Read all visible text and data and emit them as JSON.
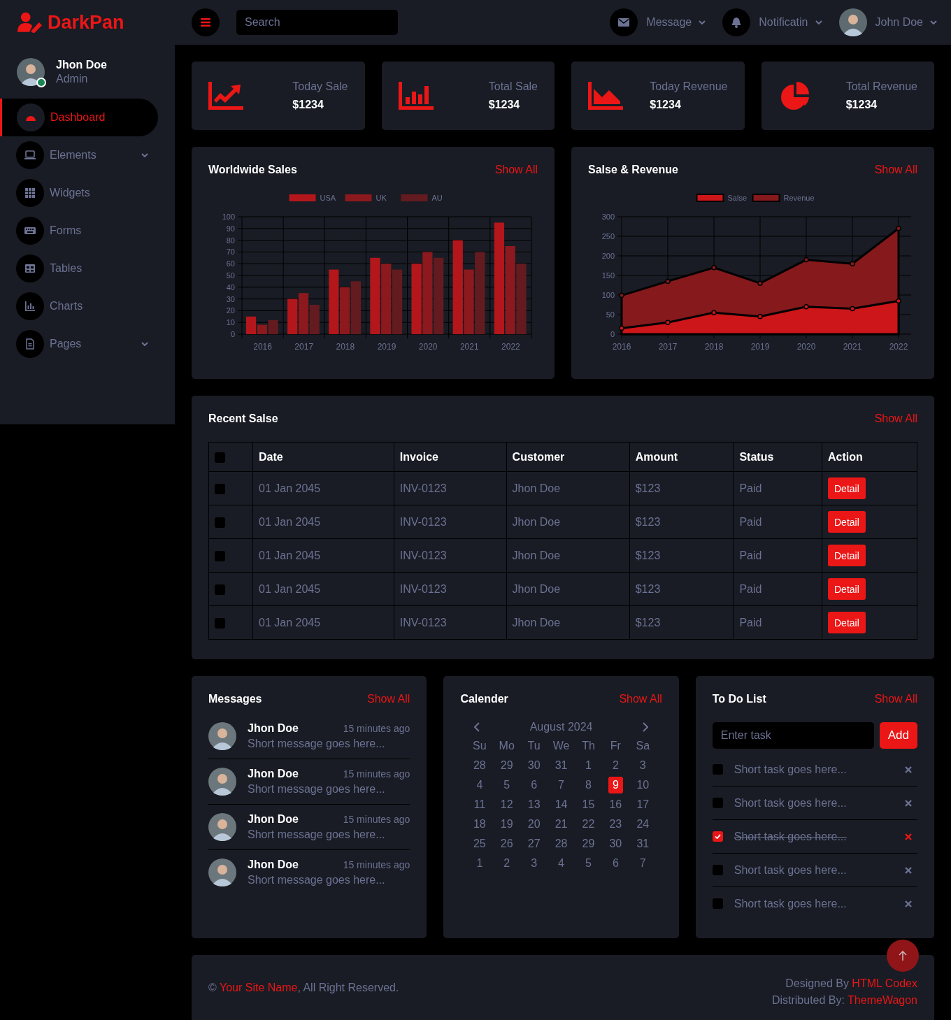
{
  "brand": {
    "name": "DarkPan"
  },
  "user": {
    "name": "Jhon Doe",
    "role": "Admin",
    "online": true
  },
  "sidebar": {
    "items": [
      {
        "label": "Dashboard",
        "kind": "gauge",
        "selected": true,
        "has_submenu": false
      },
      {
        "label": "Elements",
        "kind": "laptop",
        "selected": false,
        "has_submenu": true
      },
      {
        "label": "Widgets",
        "kind": "grid",
        "selected": false,
        "has_submenu": false
      },
      {
        "label": "Forms",
        "kind": "keyboard",
        "selected": false,
        "has_submenu": false
      },
      {
        "label": "Tables",
        "kind": "table",
        "selected": false,
        "has_submenu": false
      },
      {
        "label": "Charts",
        "kind": "chart",
        "selected": false,
        "has_submenu": false
      },
      {
        "label": "Pages",
        "kind": "file",
        "selected": false,
        "has_submenu": true
      }
    ]
  },
  "topbar": {
    "search": {
      "placeholder": "Search"
    },
    "items": [
      {
        "label": "Message",
        "kind": "envelope"
      },
      {
        "label": "Notificatin",
        "kind": "bell"
      },
      {
        "label": "John Doe",
        "kind": "avatar"
      }
    ]
  },
  "stats": [
    {
      "label": "Today Sale",
      "value": "$1234",
      "kind": "line"
    },
    {
      "label": "Total Sale",
      "value": "$1234",
      "kind": "bar"
    },
    {
      "label": "Today Revenue",
      "value": "$1234",
      "kind": "area"
    },
    {
      "label": "Total Revenue",
      "value": "$1234",
      "kind": "pie"
    }
  ],
  "charts": [
    {
      "title": "Worldwide Sales",
      "link": "Show All",
      "chart_data": {
        "type": "bar",
        "grid": true,
        "legend": "top",
        "categories": [
          "2016",
          "2017",
          "2018",
          "2019",
          "2020",
          "2021",
          "2022"
        ],
        "ylim": [
          0,
          100
        ],
        "yticks": [
          0,
          10,
          20,
          30,
          40,
          50,
          60,
          70,
          80,
          90,
          100
        ],
        "series": [
          {
            "name": "USA",
            "color": "#b3171b",
            "values": [
              15,
              30,
              55,
              65,
              60,
              80,
              95
            ]
          },
          {
            "name": "UK",
            "color": "#8c191d",
            "values": [
              8,
              35,
              40,
              60,
              70,
              55,
              75
            ]
          },
          {
            "name": "AU",
            "color": "#641b1f",
            "values": [
              12,
              25,
              45,
              55,
              65,
              70,
              60
            ]
          }
        ]
      }
    },
    {
      "title": "Salse & Revenue",
      "link": "Show All",
      "chart_data": {
        "type": "area",
        "grid": true,
        "legend": "top",
        "categories": [
          "2016",
          "2017",
          "2018",
          "2019",
          "2020",
          "2021",
          "2022"
        ],
        "ylim": [
          0,
          300
        ],
        "yticks": [
          0,
          50,
          100,
          150,
          200,
          250,
          300
        ],
        "series": [
          {
            "name": "Salse",
            "color": "#cc1619",
            "values": [
              15,
              30,
              55,
              45,
              70,
              65,
              85
            ]
          },
          {
            "name": "Revenue",
            "color": "#85191c",
            "values": [
              99,
              135,
              170,
              130,
              190,
              180,
              270
            ]
          }
        ]
      }
    }
  ],
  "recent_sales": {
    "title": "Recent Salse",
    "link": "Show All",
    "select_all": {
      "checked": false
    },
    "columns": [
      "Date",
      "Invoice",
      "Customer",
      "Amount",
      "Status",
      "Action"
    ],
    "rows": [
      {
        "checked": false,
        "date": "01 Jan 2045",
        "invoice": "INV-0123",
        "customer": "Jhon Doe",
        "amount": "$123",
        "status": "Paid",
        "action": "Detail"
      },
      {
        "checked": false,
        "date": "01 Jan 2045",
        "invoice": "INV-0123",
        "customer": "Jhon Doe",
        "amount": "$123",
        "status": "Paid",
        "action": "Detail"
      },
      {
        "checked": false,
        "date": "01 Jan 2045",
        "invoice": "INV-0123",
        "customer": "Jhon Doe",
        "amount": "$123",
        "status": "Paid",
        "action": "Detail"
      },
      {
        "checked": false,
        "date": "01 Jan 2045",
        "invoice": "INV-0123",
        "customer": "Jhon Doe",
        "amount": "$123",
        "status": "Paid",
        "action": "Detail"
      },
      {
        "checked": false,
        "date": "01 Jan 2045",
        "invoice": "INV-0123",
        "customer": "Jhon Doe",
        "amount": "$123",
        "status": "Paid",
        "action": "Detail"
      }
    ]
  },
  "messages": {
    "title": "Messages",
    "link": "Show All",
    "items": [
      {
        "name": "Jhon Doe",
        "time": "15 minutes ago",
        "text": "Short message goes here..."
      },
      {
        "name": "Jhon Doe",
        "time": "15 minutes ago",
        "text": "Short message goes here..."
      },
      {
        "name": "Jhon Doe",
        "time": "15 minutes ago",
        "text": "Short message goes here..."
      },
      {
        "name": "Jhon Doe",
        "time": "15 minutes ago",
        "text": "Short message goes here..."
      }
    ]
  },
  "calendar": {
    "title": "Calender",
    "link": "Show All",
    "month": "August 2024",
    "weekdays": [
      "Su",
      "Mo",
      "Tu",
      "We",
      "Th",
      "Fr",
      "Sa"
    ],
    "days": [
      {
        "d": "28",
        "selected": false
      },
      {
        "d": "29",
        "selected": false
      },
      {
        "d": "30",
        "selected": false
      },
      {
        "d": "31",
        "selected": false
      },
      {
        "d": "1",
        "selected": false
      },
      {
        "d": "2",
        "selected": false
      },
      {
        "d": "3",
        "selected": false
      },
      {
        "d": "4",
        "selected": false
      },
      {
        "d": "5",
        "selected": false
      },
      {
        "d": "6",
        "selected": false
      },
      {
        "d": "7",
        "selected": false
      },
      {
        "d": "8",
        "selected": false
      },
      {
        "d": "9",
        "selected": true
      },
      {
        "d": "10",
        "selected": false
      },
      {
        "d": "11",
        "selected": false
      },
      {
        "d": "12",
        "selected": false
      },
      {
        "d": "13",
        "selected": false
      },
      {
        "d": "14",
        "selected": false
      },
      {
        "d": "15",
        "selected": false
      },
      {
        "d": "16",
        "selected": false
      },
      {
        "d": "17",
        "selected": false
      },
      {
        "d": "18",
        "selected": false
      },
      {
        "d": "19",
        "selected": false
      },
      {
        "d": "20",
        "selected": false
      },
      {
        "d": "21",
        "selected": false
      },
      {
        "d": "22",
        "selected": false
      },
      {
        "d": "23",
        "selected": false
      },
      {
        "d": "24",
        "selected": false
      },
      {
        "d": "25",
        "selected": false
      },
      {
        "d": "26",
        "selected": false
      },
      {
        "d": "27",
        "selected": false
      },
      {
        "d": "28",
        "selected": false
      },
      {
        "d": "29",
        "selected": false
      },
      {
        "d": "30",
        "selected": false
      },
      {
        "d": "31",
        "selected": false
      },
      {
        "d": "1",
        "selected": false
      },
      {
        "d": "2",
        "selected": false
      },
      {
        "d": "3",
        "selected": false
      },
      {
        "d": "4",
        "selected": false
      },
      {
        "d": "5",
        "selected": false
      },
      {
        "d": "6",
        "selected": false
      },
      {
        "d": "7",
        "selected": false
      }
    ]
  },
  "todo": {
    "title": "To Do List",
    "link": "Show All",
    "input": {
      "placeholder": "Enter task"
    },
    "add_button": "Add",
    "tasks": [
      {
        "text": "Short task goes here...",
        "done": false
      },
      {
        "text": "Short task goes here...",
        "done": false
      },
      {
        "text": "Short task goes here...",
        "done": true
      },
      {
        "text": "Short task goes here...",
        "done": false
      },
      {
        "text": "Short task goes here...",
        "done": false
      }
    ]
  },
  "footer": {
    "copyright_prefix": "©",
    "site_link": "Your Site Name",
    "copyright_suffix": ", All Right Reserved.",
    "designed_by": "Designed By",
    "designer_link": "HTML Codex",
    "distributed_by": "Distributed By:",
    "distributor_link": "ThemeWagon"
  }
}
